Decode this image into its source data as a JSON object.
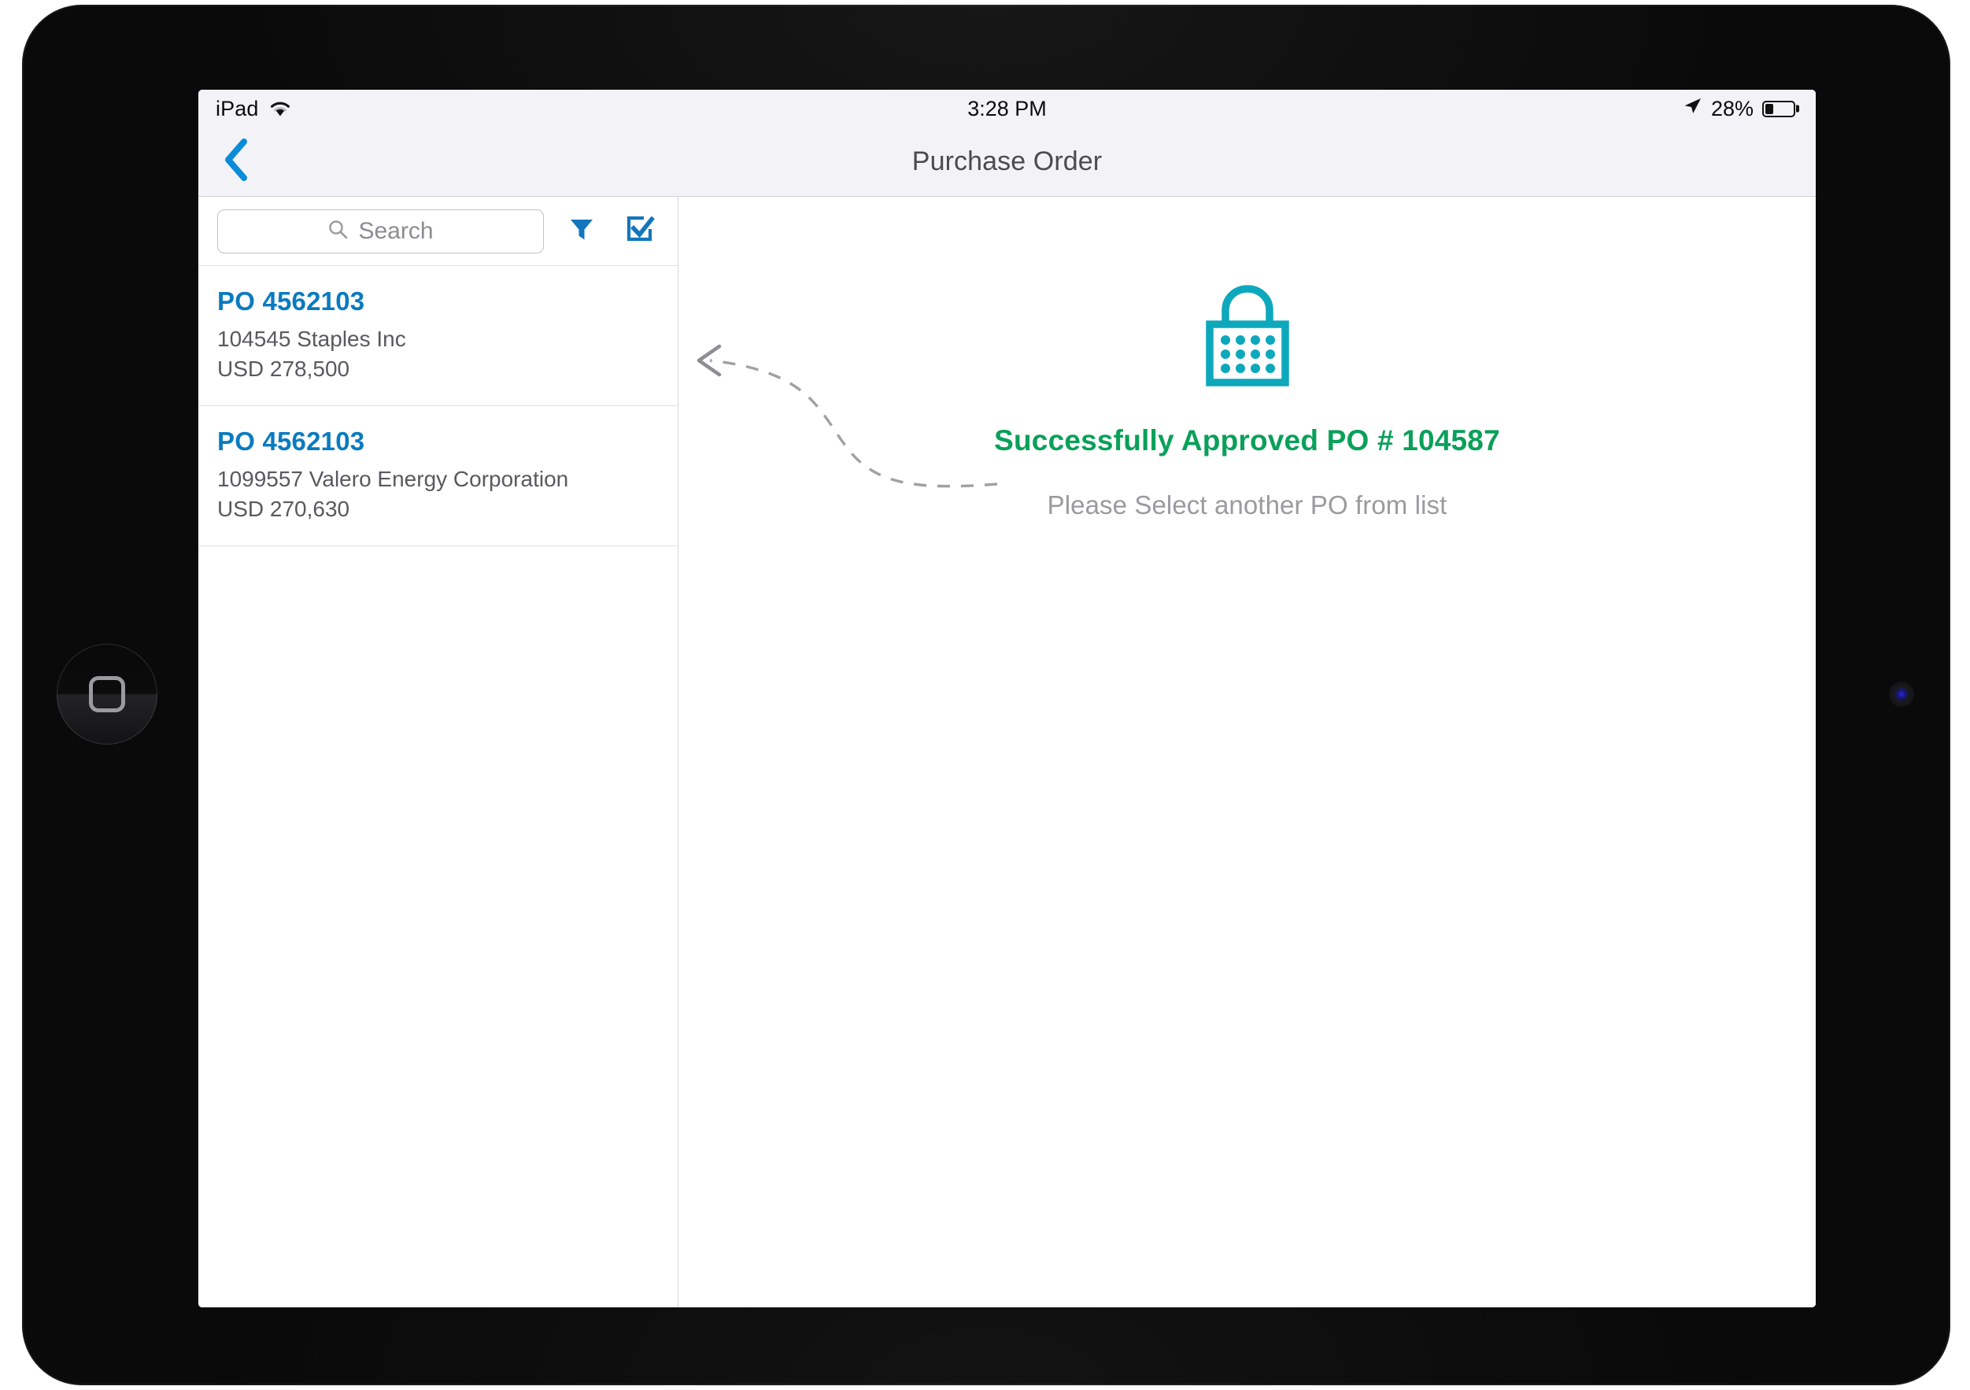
{
  "status_bar": {
    "device_name": "iPad",
    "wifi_icon": "wifi-icon",
    "time": "3:28 PM",
    "location_icon": "location-arrow-icon",
    "battery_percent": "28%",
    "battery_level_value": 28,
    "battery_icon": "battery-icon"
  },
  "nav_bar": {
    "back_icon": "chevron-left-icon",
    "title": "Purchase Order"
  },
  "search": {
    "placeholder": "Search",
    "value": "",
    "search_icon": "search-icon"
  },
  "toolbar": {
    "filter_icon": "filter-funnel-icon",
    "select_icon": "checkbox-check-icon"
  },
  "list": {
    "items": [
      {
        "po_id": "PO 4562103",
        "vendor": "104545 Staples Inc",
        "amount": "USD 278,500"
      },
      {
        "po_id": "PO 4562103",
        "vendor": "1099557 Valero Energy Corporation",
        "amount": "USD 270,630"
      }
    ]
  },
  "detail": {
    "lock_icon": "lock-icon",
    "success_message": "Successfully Approved PO # 104587",
    "hint_message": "Please Select another PO from list",
    "hint_arrow_icon": "dashed-curved-arrow-left-icon"
  },
  "device": {
    "home_button_icon": "home-button-icon",
    "camera_icon": "front-camera-icon"
  },
  "colors": {
    "accent_blue": "#0a7bc0",
    "success_green": "#0aa05a",
    "lock_teal": "#0da8bc",
    "muted_gray": "#9a9a9f",
    "chrome_gray": "#f3f3f7"
  }
}
